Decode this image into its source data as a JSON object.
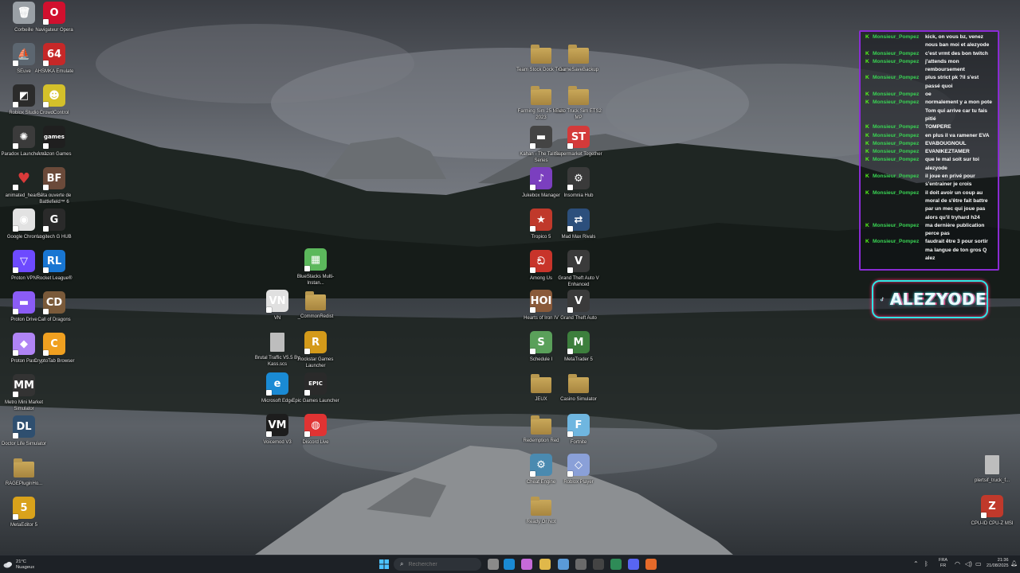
{
  "desktop_icons": [
    {
      "id": "corbeille",
      "label": "Corbeille",
      "type": "bin",
      "bg": "#9aa0a6",
      "glyph": "🗑"
    },
    {
      "id": "opera",
      "label": "Navigateur Opera",
      "type": "app",
      "bg": "#d1102e",
      "glyph": "O"
    },
    {
      "id": "se",
      "label": "SEuve",
      "type": "app",
      "bg": "#5c6670",
      "glyph": "⛵"
    },
    {
      "id": "n64",
      "label": "AHSMKA Emulate",
      "type": "app",
      "bg": "#c62828",
      "glyph": "64"
    },
    {
      "id": "roblox-studio",
      "label": "Roblox Studio",
      "type": "app",
      "bg": "#2b2b2b",
      "glyph": "◩"
    },
    {
      "id": "crowdcontrol",
      "label": "CrowdControl",
      "type": "app",
      "bg": "#d4c02a",
      "glyph": "☻"
    },
    {
      "id": "paradox",
      "label": "Paradox Launcher v2",
      "type": "app",
      "bg": "#3b3b3b",
      "glyph": "✺"
    },
    {
      "id": "amazon-games",
      "label": "Amazon Games",
      "type": "app",
      "bg": "#1f1f1f",
      "glyph": "games"
    },
    {
      "id": "animated-heart",
      "label": "animated_heart...",
      "type": "app",
      "bg": "transparent",
      "glyph": "♥"
    },
    {
      "id": "bf6",
      "label": "Bêta ouverte de Battlefield™ 6",
      "type": "app",
      "bg": "#6b4a3a",
      "glyph": "BF"
    },
    {
      "id": "chrome",
      "label": "Google Chrome",
      "type": "app",
      "bg": "#e2e2e2",
      "glyph": "◉"
    },
    {
      "id": "logitech",
      "label": "Logitech G HUB",
      "type": "app",
      "bg": "#2a2a2a",
      "glyph": "G"
    },
    {
      "id": "proton-vpn",
      "label": "Proton VPN",
      "type": "app",
      "bg": "#6d4aff",
      "glyph": "▽"
    },
    {
      "id": "rocket-league",
      "label": "Rocket League®",
      "type": "app",
      "bg": "#1976d2",
      "glyph": "RL"
    },
    {
      "id": "proton-drive",
      "label": "Proton Drive",
      "type": "app",
      "bg": "#8b5cf6",
      "glyph": "▬"
    },
    {
      "id": "call-of-dragons",
      "label": "Call of Dragons",
      "type": "app",
      "bg": "#7a5a3a",
      "glyph": "CD"
    },
    {
      "id": "proton-pass",
      "label": "Proton Pass",
      "type": "app",
      "bg": "#b084f5",
      "glyph": "◆"
    },
    {
      "id": "cryptotab",
      "label": "CryptoTab Browser",
      "type": "app",
      "bg": "#f0a020",
      "glyph": "C"
    },
    {
      "id": "metro-mini",
      "label": "Metro Mini Market Simulator",
      "type": "app",
      "bg": "#333",
      "glyph": "MM"
    },
    {
      "id": "doctor-life",
      "label": "Doctor Life Simulator",
      "type": "app",
      "bg": "#2f4f6f",
      "glyph": "DL"
    },
    {
      "id": "ragpluginhook",
      "label": "RAGEPluginHo...",
      "type": "folder"
    },
    {
      "id": "metaeditor",
      "label": "MetaEditor 5",
      "type": "app",
      "bg": "#d9a21b",
      "glyph": "5"
    },
    {
      "id": "vn",
      "label": "VN",
      "type": "app",
      "bg": "#e0e0e0",
      "glyph": "VN"
    },
    {
      "id": "bluestacks",
      "label": "BlueStacks Multi-Instan...",
      "type": "app",
      "bg": "#5cb85c",
      "glyph": "▦"
    },
    {
      "id": "commonredist",
      "label": "_CommonRedist",
      "type": "folder"
    },
    {
      "id": "brutal-traffic",
      "label": "Brutal Traffic V5.5 By Kass.scs",
      "type": "file"
    },
    {
      "id": "rockstar-launcher",
      "label": "Rockstar Games Launcher",
      "type": "app",
      "bg": "#d49a1a",
      "glyph": "R"
    },
    {
      "id": "edge",
      "label": "Microsoft Edge",
      "type": "app",
      "bg": "#1a8ad4",
      "glyph": "e"
    },
    {
      "id": "epic",
      "label": "Epic Games Launcher",
      "type": "app",
      "bg": "#2a2a2a",
      "glyph": "EPIC"
    },
    {
      "id": "voicemod",
      "label": "Voicemod V3",
      "type": "app",
      "bg": "#1d1d1d",
      "glyph": "VM"
    },
    {
      "id": "mcdo",
      "label": "Discord Live",
      "type": "app",
      "bg": "#e03333",
      "glyph": "◍"
    },
    {
      "id": "folder-tr1",
      "label": "Team Stock Dock Tract",
      "type": "folder"
    },
    {
      "id": "folder-tr2",
      "label": "GameSaveBackup",
      "type": "folder"
    },
    {
      "id": "folder-tr3",
      "label": "Farming Sim 25 Mods 2023",
      "type": "folder"
    },
    {
      "id": "folder-tr4",
      "label": "Euro Truck Sim ETS2 MP",
      "type": "folder"
    },
    {
      "id": "firewatch",
      "label": "Kahan - The Talltale Series",
      "type": "app",
      "bg": "#444",
      "glyph": "▬"
    },
    {
      "id": "supermarket",
      "label": "Supermarket Together",
      "type": "app",
      "bg": "#d43a3a",
      "glyph": "ST"
    },
    {
      "id": "soundblast",
      "label": "Jukebox Manager",
      "type": "app",
      "bg": "#7b3fbf",
      "glyph": "♪"
    },
    {
      "id": "pwnagotchi",
      "label": "Insomnia Hub",
      "type": "app",
      "bg": "#3a3a3a",
      "glyph": "⚙"
    },
    {
      "id": "tropico",
      "label": "Tropico 5",
      "type": "app",
      "bg": "#c0392b",
      "glyph": "★"
    },
    {
      "id": "mayhem",
      "label": "Mad Max Rivals",
      "type": "app",
      "bg": "#2c4f7c",
      "glyph": "⇄"
    },
    {
      "id": "among-us",
      "label": "Among Us",
      "type": "app",
      "bg": "#c8342a",
      "glyph": "ඞ"
    },
    {
      "id": "gta5",
      "label": "Grand Theft Auto V Enhanced",
      "type": "app",
      "bg": "#3a3a3a",
      "glyph": "V"
    },
    {
      "id": "hoi",
      "label": "Hearts of Iron IV",
      "type": "app",
      "bg": "#8a5a3a",
      "glyph": "HOI"
    },
    {
      "id": "gta-auto",
      "label": "Grand Theft Auto",
      "type": "app",
      "bg": "#3a3a3a",
      "glyph": "V"
    },
    {
      "id": "schedule1",
      "label": "Schedule I",
      "type": "app",
      "bg": "#5aa05a",
      "glyph": "S"
    },
    {
      "id": "metatrader",
      "label": "MetaTrader 5",
      "type": "app",
      "bg": "#3d7f3d",
      "glyph": "M"
    },
    {
      "id": "jeux",
      "label": "JEUX",
      "type": "folder"
    },
    {
      "id": "casino-sim",
      "label": "Casino Simulator",
      "type": "folder"
    },
    {
      "id": "rdr",
      "label": "Redemption Red",
      "type": "folder"
    },
    {
      "id": "fortnite",
      "label": "Fortnite",
      "type": "app",
      "bg": "#6fb6e0",
      "glyph": "F"
    },
    {
      "id": "cheat-engine",
      "label": "Cheat Engine",
      "type": "app",
      "bg": "#4a8ab0",
      "glyph": "⚙"
    },
    {
      "id": "roblox",
      "label": "Roblox Player",
      "type": "app",
      "bg": "#8aa0d8",
      "glyph": "◇"
    },
    {
      "id": "folder-bottom",
      "label": "Ready Or Not",
      "type": "folder"
    },
    {
      "id": "plertsif",
      "label": "plertsif_truck_f...",
      "type": "file"
    },
    {
      "id": "cpuz",
      "label": "CPU-ID CPU-Z MSI",
      "type": "app",
      "bg": "#c0392b",
      "glyph": "Z"
    }
  ],
  "chat": {
    "messages": [
      {
        "user": "Monsieur_Pompez",
        "text": "kick, on vous bz, venez nous ban moi et alezyode"
      },
      {
        "user": "Monsieur_Pompez",
        "text": "c'est vrmt des bon twitch"
      },
      {
        "user": "Monsieur_Pompez",
        "text": "j'attends mon remboursement"
      },
      {
        "user": "Monsieur_Pompez",
        "text": "plus strict pk ?il s'est passé quoi"
      },
      {
        "user": "Monsieur_Pompez",
        "text": "oe"
      },
      {
        "user": "Monsieur_Pompez",
        "text": "normalement y a mon pote Tom qui arrive car tu fais pitié"
      },
      {
        "user": "Monsieur_Pompez",
        "text": "TOMPERE"
      },
      {
        "user": "Monsieur_Pompez",
        "text": "en plus il va ramener EVA"
      },
      {
        "user": "Monsieur_Pompez",
        "text": "EVABOUGNOUL"
      },
      {
        "user": "Monsieur_Pompez",
        "text": "EVANIKEZTAMER"
      },
      {
        "user": "Monsieur_Pompez",
        "text": "que le mal soit sur toi alezyode"
      },
      {
        "user": "Monsieur_Pompez",
        "text": "il joue en privé pour s'entrainer je crois"
      },
      {
        "user": "Monsieur_Pompez",
        "text": "il doit avoir un coup au moral de s'être fait battre par un mec qui joue pas alors qu'il tryhard h24"
      },
      {
        "user": "Monsieur_Pompez",
        "text": "ma dernière publication perce pas"
      },
      {
        "user": "Monsieur_Pompez",
        "text": "faudrait être 3 pour sortir ma langue de ton gros Q alez"
      }
    ],
    "badge_glyph": "K"
  },
  "tiktok": {
    "name": "ALEZYODE"
  },
  "taskbar": {
    "weather": {
      "temp": "21°C",
      "condition": "Nuageux"
    },
    "search_placeholder": "Rechercher",
    "lang": {
      "line1": "FRA",
      "line2": "FR"
    },
    "clock": {
      "time": "21:36",
      "date": "21/08/2025"
    },
    "apps": [
      {
        "id": "task-view",
        "color": "#8a8a8a"
      },
      {
        "id": "edge",
        "color": "#1a8ad4"
      },
      {
        "id": "copilot",
        "color": "#c56ad9"
      },
      {
        "id": "explorer",
        "color": "#e0b84a"
      },
      {
        "id": "store",
        "color": "#5a9ad8"
      },
      {
        "id": "calculator",
        "color": "#6a6a6a"
      },
      {
        "id": "terminal",
        "color": "#444"
      },
      {
        "id": "excel",
        "color": "#2e8b57"
      },
      {
        "id": "discord",
        "color": "#5865f2"
      },
      {
        "id": "firefox",
        "color": "#e56a2a"
      }
    ]
  }
}
